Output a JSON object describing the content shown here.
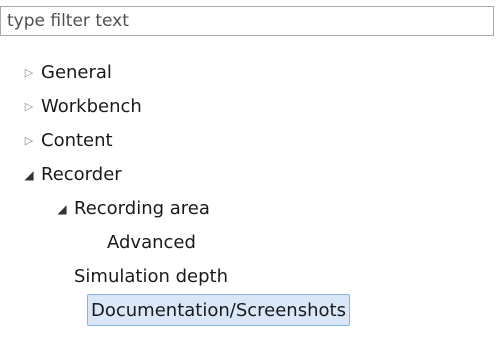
{
  "filter": {
    "placeholder": "type filter text",
    "value": ""
  },
  "tree": {
    "items": [
      {
        "label": "General",
        "level": 0,
        "state": "collapsed"
      },
      {
        "label": "Workbench",
        "level": 0,
        "state": "collapsed"
      },
      {
        "label": "Content",
        "level": 0,
        "state": "collapsed"
      },
      {
        "label": "Recorder",
        "level": 0,
        "state": "expanded"
      },
      {
        "label": "Recording area",
        "level": 1,
        "state": "expanded"
      },
      {
        "label": "Advanced",
        "level": 2,
        "state": "leaf"
      },
      {
        "label": "Simulation depth",
        "level": 1,
        "state": "leaf"
      },
      {
        "label": "Documentation/Screenshots",
        "level": 1,
        "state": "leaf",
        "selected": true
      }
    ]
  },
  "colors": {
    "selection_bg": "#d9e7f8",
    "selection_border": "#88b0e0",
    "twisty_collapsed": "#8a8a8a",
    "twisty_expanded": "#333333"
  },
  "icons": {
    "collapsed": "chevron-right-outline-icon",
    "expanded": "triangle-down-filled-icon"
  }
}
